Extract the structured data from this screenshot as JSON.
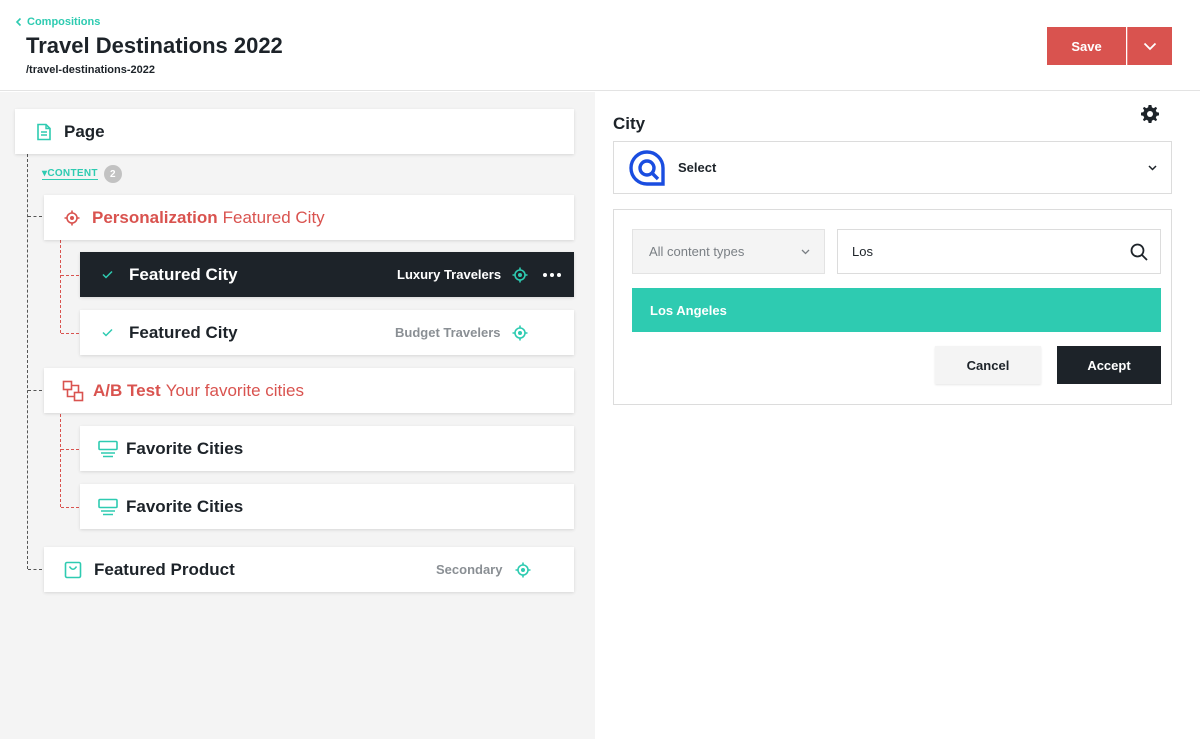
{
  "header": {
    "back_label": "Compositions",
    "title": "Travel Destinations 2022",
    "slug": "/travel-destinations-2022",
    "save_label": "Save"
  },
  "tree": {
    "root_label": "Page",
    "content_label": "CONTENT",
    "content_count": "2",
    "personalization": {
      "type": "Personalization",
      "name": "Featured City"
    },
    "variants": [
      {
        "label": "Featured City",
        "criteria": "Luxury Travelers",
        "selected": true
      },
      {
        "label": "Featured City",
        "criteria": "Budget Travelers",
        "selected": false
      }
    ],
    "ab_test": {
      "type": "A/B Test",
      "name": "Your favorite cities"
    },
    "ab_items": [
      {
        "label": "Favorite Cities"
      },
      {
        "label": "Favorite Cities"
      }
    ],
    "product": {
      "label": "Featured Product",
      "criteria": "Secondary"
    }
  },
  "editor": {
    "field_label": "City",
    "select_text": "Select",
    "type_filter": "All content types",
    "search_value": "Los",
    "result": "Los Angeles",
    "cancel_label": "Cancel",
    "accept_label": "Accept"
  },
  "colors": {
    "accent": "#2ecbb1",
    "danger": "#d9534f",
    "dark": "#1d2329",
    "panel_bg": "#f4f4f4",
    "logo_blue": "#1a4de0"
  }
}
